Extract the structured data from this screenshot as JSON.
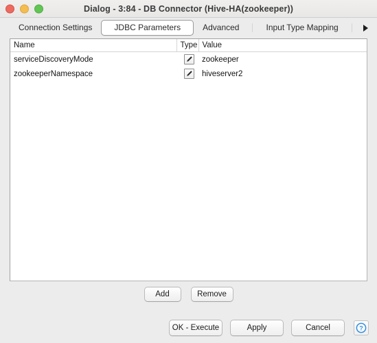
{
  "window": {
    "title": "Dialog - 3:84 - DB Connector (Hive-HA(zookeeper))",
    "controls": {
      "close": "close-button",
      "minimize": "minimize-button",
      "maximize": "maximize-button"
    }
  },
  "tabs": [
    {
      "label": "Connection Settings",
      "selected": false
    },
    {
      "label": "JDBC Parameters",
      "selected": true
    },
    {
      "label": "Advanced",
      "selected": false
    },
    {
      "label": "Input Type Mapping",
      "selected": false
    }
  ],
  "tab_overflow": {
    "icon": "triangle-right-icon",
    "label": "▶"
  },
  "table": {
    "columns": [
      "Name",
      "Type",
      "Value"
    ],
    "rows": [
      {
        "name": "serviceDiscoveryMode",
        "type_icon": "pencil-icon",
        "value": "zookeeper"
      },
      {
        "name": "zookeeperNamespace",
        "type_icon": "pencil-icon",
        "value": "hiveserver2"
      }
    ]
  },
  "row_actions": {
    "add_label": "Add",
    "remove_label": "Remove"
  },
  "footer": {
    "ok_label": "OK - Execute",
    "apply_label": "Apply",
    "cancel_label": "Cancel",
    "help_icon": "help-question-icon"
  },
  "colors": {
    "accent": "#2f8ee0",
    "window_bg": "#ececec",
    "panel_bg": "#ffffff",
    "close": "#ec6a5f",
    "minimize": "#f4bd50",
    "maximize": "#62c554"
  }
}
